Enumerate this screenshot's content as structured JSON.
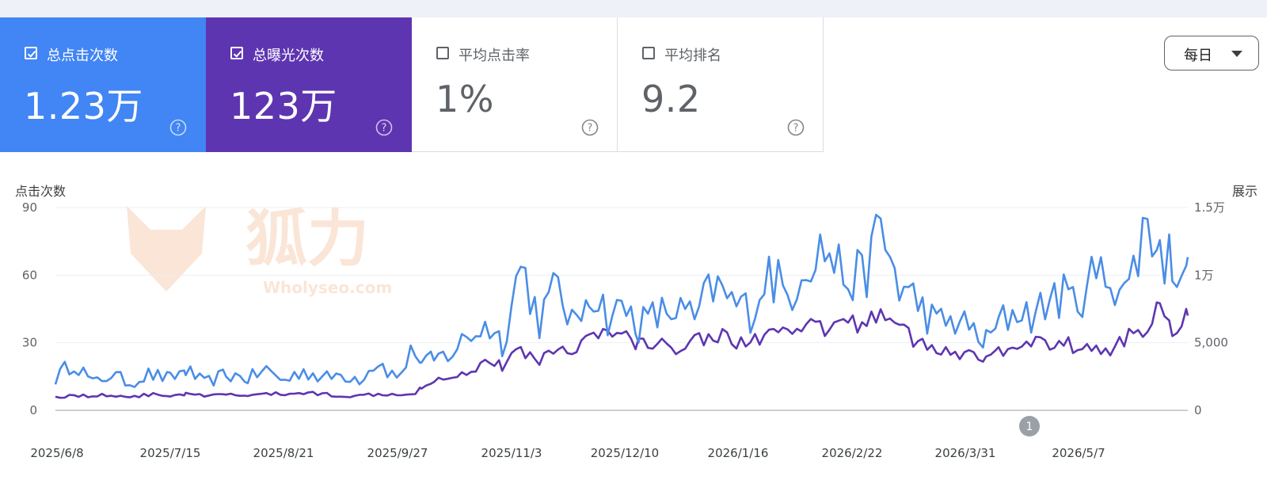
{
  "metrics": {
    "clicks": {
      "label": "总点击次数",
      "value": "1.23万",
      "checked": true,
      "color": "#4285f4"
    },
    "impressions": {
      "label": "总曝光次数",
      "value": "123万",
      "checked": true,
      "color": "#5e35b1"
    },
    "ctr": {
      "label": "平均点击率",
      "value": "1%",
      "checked": false
    },
    "position": {
      "label": "平均排名",
      "value": "9.2",
      "checked": false
    }
  },
  "granularity": {
    "selected": "每日"
  },
  "watermark": {
    "title": "狐力",
    "site": "Wholyseo.com",
    "color": "#f0a673"
  },
  "annotation_marker": "1",
  "icons": {
    "checkbox": "checkbox-icon",
    "help": "help-icon",
    "dropdown": "chevron-down-icon"
  },
  "chart_data": {
    "type": "line",
    "title": "",
    "y_left_label": "点击次数",
    "y_right_label": "展示",
    "y_left_ticks": [
      "0",
      "30",
      "60",
      "90"
    ],
    "y_right_ticks": [
      "0",
      "5,000",
      "1万",
      "1.5万"
    ],
    "ylim_left": [
      0,
      90
    ],
    "ylim_right": [
      0,
      15000
    ],
    "x_tick_labels": [
      "2025/6/8",
      "2025/7/15",
      "2025/8/21",
      "2025/9/27",
      "2025/11/3",
      "2025/12/10",
      "2026/1/16",
      "2026/2/22",
      "2026/3/31",
      "2026/5/7"
    ],
    "x_range": [
      "2025/6/8",
      "2026/6/8"
    ],
    "grid": true,
    "series": [
      {
        "name": "点击次数",
        "axis": "left",
        "color": "#4a8de6",
        "x_days": [
          0,
          6,
          12,
          18,
          24,
          30,
          37,
          42,
          48,
          55,
          62,
          68,
          74,
          80,
          86,
          92,
          98,
          104,
          110,
          116,
          118,
          122,
          128,
          134,
          140,
          144,
          150,
          156,
          162,
          168,
          172,
          178,
          184,
          188,
          194,
          200,
          206,
          212,
          218,
          224,
          230,
          236,
          242,
          248,
          254,
          260,
          266,
          272,
          278,
          284,
          290,
          296,
          300,
          304,
          310,
          316,
          322,
          328,
          334,
          340,
          346,
          352,
          356,
          360,
          365
        ],
        "values": [
          14,
          22,
          12,
          16,
          12,
          16,
          14,
          18,
          12,
          16,
          14,
          18,
          13,
          18,
          14,
          16,
          14,
          22,
          14,
          28,
          20,
          22,
          26,
          34,
          38,
          30,
          65,
          40,
          55,
          35,
          56,
          42,
          45,
          38,
          42,
          45,
          40,
          55,
          48,
          44,
          62,
          50,
          68,
          72,
          60,
          58,
          80,
          55,
          48,
          38,
          40,
          35,
          30,
          38,
          45,
          42,
          52,
          48,
          58,
          60,
          54,
          86,
          70,
          66,
          68
        ]
      },
      {
        "name": "展示",
        "axis": "right",
        "color": "#5e35b1",
        "x_days": [
          0,
          6,
          12,
          18,
          24,
          30,
          37,
          42,
          48,
          55,
          62,
          68,
          74,
          80,
          86,
          92,
          98,
          104,
          110,
          116,
          118,
          122,
          128,
          134,
          140,
          144,
          150,
          156,
          162,
          168,
          172,
          178,
          184,
          188,
          194,
          200,
          206,
          212,
          218,
          224,
          230,
          236,
          242,
          248,
          254,
          260,
          266,
          272,
          278,
          284,
          290,
          296,
          300,
          304,
          310,
          316,
          322,
          328,
          334,
          340,
          346,
          352,
          356,
          360,
          365
        ],
        "values": [
          1000,
          1100,
          1050,
          1150,
          1000,
          1150,
          1100,
          1200,
          1050,
          1150,
          1100,
          1200,
          1200,
          1300,
          1200,
          1100,
          1050,
          1250,
          1200,
          1300,
          1800,
          2200,
          2600,
          2900,
          3800,
          3200,
          4500,
          3800,
          4400,
          4800,
          5400,
          5700,
          5400,
          5000,
          4800,
          4700,
          5300,
          5600,
          5200,
          5000,
          5800,
          5400,
          6200,
          6000,
          6500,
          6400,
          7200,
          6800,
          4800,
          4500,
          4200,
          4000,
          3800,
          4200,
          5100,
          4900,
          5000,
          4800,
          4600,
          4200,
          5600,
          6200,
          7500,
          6200,
          7000
        ]
      }
    ]
  }
}
